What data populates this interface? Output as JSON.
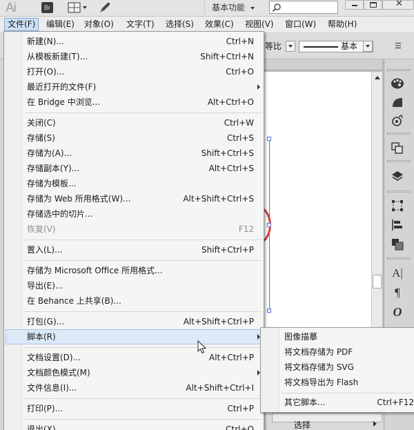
{
  "app": {
    "logo": "Ai",
    "bridge_badge": "Br",
    "workspace": "基本功能",
    "search_placeholder": ""
  },
  "menubar": [
    {
      "label": "文件(F)",
      "active": true
    },
    {
      "label": "编辑(E)"
    },
    {
      "label": "对象(O)"
    },
    {
      "label": "文字(T)"
    },
    {
      "label": "选择(S)"
    },
    {
      "label": "效果(C)"
    },
    {
      "label": "视图(V)"
    },
    {
      "label": "窗口(W)"
    },
    {
      "label": "帮助(H)"
    }
  ],
  "control_bar": {
    "profile_label": "等比",
    "stroke_style": "基本"
  },
  "file_menu": {
    "items": [
      {
        "label": "新建(N)...",
        "shortcut": "Ctrl+N"
      },
      {
        "label": "从模板新建(T)...",
        "shortcut": "Shift+Ctrl+N"
      },
      {
        "label": "打开(O)...",
        "shortcut": "Ctrl+O"
      },
      {
        "label": "最近打开的文件(F)",
        "shortcut": "",
        "submenu": true
      },
      {
        "label": "在 Bridge 中浏览...",
        "shortcut": "Alt+Ctrl+O"
      },
      {
        "label": "关闭(C)",
        "shortcut": "Ctrl+W"
      },
      {
        "label": "存储(S)",
        "shortcut": "Ctrl+S"
      },
      {
        "label": "存储为(A)...",
        "shortcut": "Shift+Ctrl+S"
      },
      {
        "label": "存储副本(Y)...",
        "shortcut": "Alt+Ctrl+S"
      },
      {
        "label": "存储为模板...",
        "shortcut": ""
      },
      {
        "label": "存储为 Web 所用格式(W)...",
        "shortcut": "Alt+Shift+Ctrl+S"
      },
      {
        "label": "存储选中的切片...",
        "shortcut": ""
      },
      {
        "label": "恢复(V)",
        "shortcut": "F12",
        "disabled": true
      },
      {
        "label": "置入(L)...",
        "shortcut": "Shift+Ctrl+P"
      },
      {
        "label": "存储为 Microsoft Office 所用格式...",
        "shortcut": ""
      },
      {
        "label": "导出(E)...",
        "shortcut": ""
      },
      {
        "label": "在 Behance 上共享(B)...",
        "shortcut": ""
      },
      {
        "label": "打包(G)...",
        "shortcut": "Alt+Shift+Ctrl+P"
      },
      {
        "label": "脚本(R)",
        "shortcut": "",
        "submenu": true,
        "highlighted": true
      },
      {
        "label": "文档设置(D)...",
        "shortcut": "Alt+Ctrl+P"
      },
      {
        "label": "文档颜色模式(M)",
        "shortcut": "",
        "submenu": true
      },
      {
        "label": "文件信息(I)...",
        "shortcut": "Alt+Shift+Ctrl+I"
      },
      {
        "label": "打印(P)...",
        "shortcut": "Ctrl+P"
      },
      {
        "label": "退出(X)",
        "shortcut": "Ctrl+Q"
      }
    ]
  },
  "script_menu": {
    "items": [
      {
        "label": "图像描摹",
        "shortcut": ""
      },
      {
        "label": "将文档存储为 PDF",
        "shortcut": ""
      },
      {
        "label": "将文档存储为 SVG",
        "shortcut": ""
      },
      {
        "label": "将文档导出为 Flash",
        "shortcut": ""
      },
      {
        "label": "其它脚本...",
        "shortcut": "Ctrl+F12"
      }
    ]
  },
  "status_bar": {
    "tool_label": "选择"
  }
}
